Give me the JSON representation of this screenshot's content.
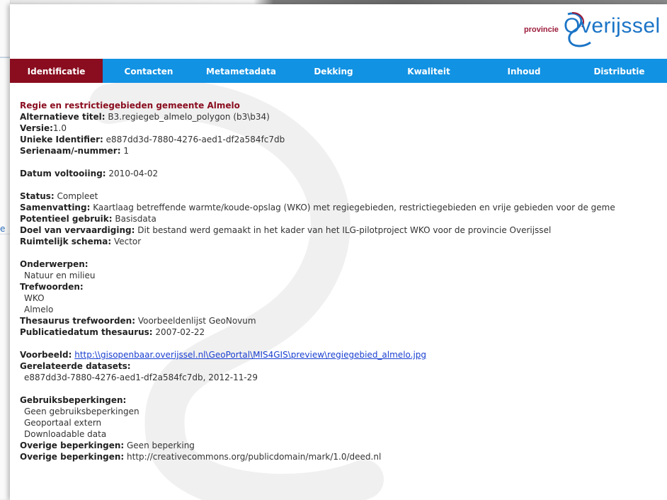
{
  "background": {
    "left_link_text": "e"
  },
  "brand": {
    "small": "provincie",
    "big": "Overijssel",
    "colors": {
      "tab_bar": "#1192e3",
      "tab_active": "#8a0d1f",
      "title": "#8a0d1f",
      "link": "#1a3fd1"
    }
  },
  "tabs": [
    {
      "label": "Identificatie",
      "active": true
    },
    {
      "label": "Contacten",
      "active": false
    },
    {
      "label": "Metametadata",
      "active": false
    },
    {
      "label": "Dekking",
      "active": false
    },
    {
      "label": "Kwaliteit",
      "active": false
    },
    {
      "label": "Inhoud",
      "active": false
    },
    {
      "label": "Distributie",
      "active": false
    }
  ],
  "record": {
    "title": "Regie en restrictiegebieden gemeente Almelo",
    "alt_title_label": "Alternatieve titel:",
    "alt_title": " B3.regiegeb_almelo_polygon (b3\\b34)",
    "version_label": "Versie:",
    "version": "1.0",
    "uid_label": "Unieke Identifier:",
    "uid": " e887dd3d-7880-4276-aed1-df2a584fc7db",
    "series_label": "Serienaam/-nummer:",
    "series": " 1",
    "completion_label": "Datum voltooiing:",
    "completion": " 2010-04-02",
    "status_label": "Status:",
    "status": " Compleet",
    "summary_label": "Samenvatting:",
    "summary": " Kaartlaag betreffende warmte/koude-opslag (WKO) met regiegebieden, restrictiegebieden en vrije gebieden voor de geme",
    "use_label": "Potentieel gebruik:",
    "use": " Basisdata",
    "purpose_label": "Doel van vervaardiging:",
    "purpose": " Dit bestand werd gemaakt in het kader van het ILG-pilotproject WKO voor de provincie Overijssel",
    "schema_label": "Ruimtelijk schema:",
    "schema": " Vector",
    "topics_label": "Onderwerpen:",
    "topics": [
      "Natuur en milieu"
    ],
    "keywords_label": "Trefwoorden:",
    "keywords": [
      "WKO",
      "Almelo"
    ],
    "thesaurus_label": "Thesaurus trefwoorden:",
    "thesaurus": " Voorbeeldenlijst GeoNovum",
    "thesaurus_date_label": "Publicatiedatum thesaurus:",
    "thesaurus_date": " 2007-02-22",
    "preview_label": "Voorbeeld:",
    "preview_link": "http:\\\\gisopenbaar.overijssel.nl\\GeoPortal\\MIS4GIS\\preview\\regiegebied_almelo.jpg",
    "related_label": "Gerelateerde datasets:",
    "related": [
      "e887dd3d-7880-4276-aed1-df2a584fc7db, 2012-11-29"
    ],
    "use_limits_label": "Gebruiksbeperkingen:",
    "use_limits": [
      "Geen gebruiksbeperkingen",
      "Geoportaal extern",
      "Downloadable data"
    ],
    "other1_label": "Overige beperkingen:",
    "other1": " Geen beperking",
    "other2_label": "Overige beperkingen:",
    "other2": " http://creativecommons.org/publicdomain/mark/1.0/deed.nl"
  }
}
